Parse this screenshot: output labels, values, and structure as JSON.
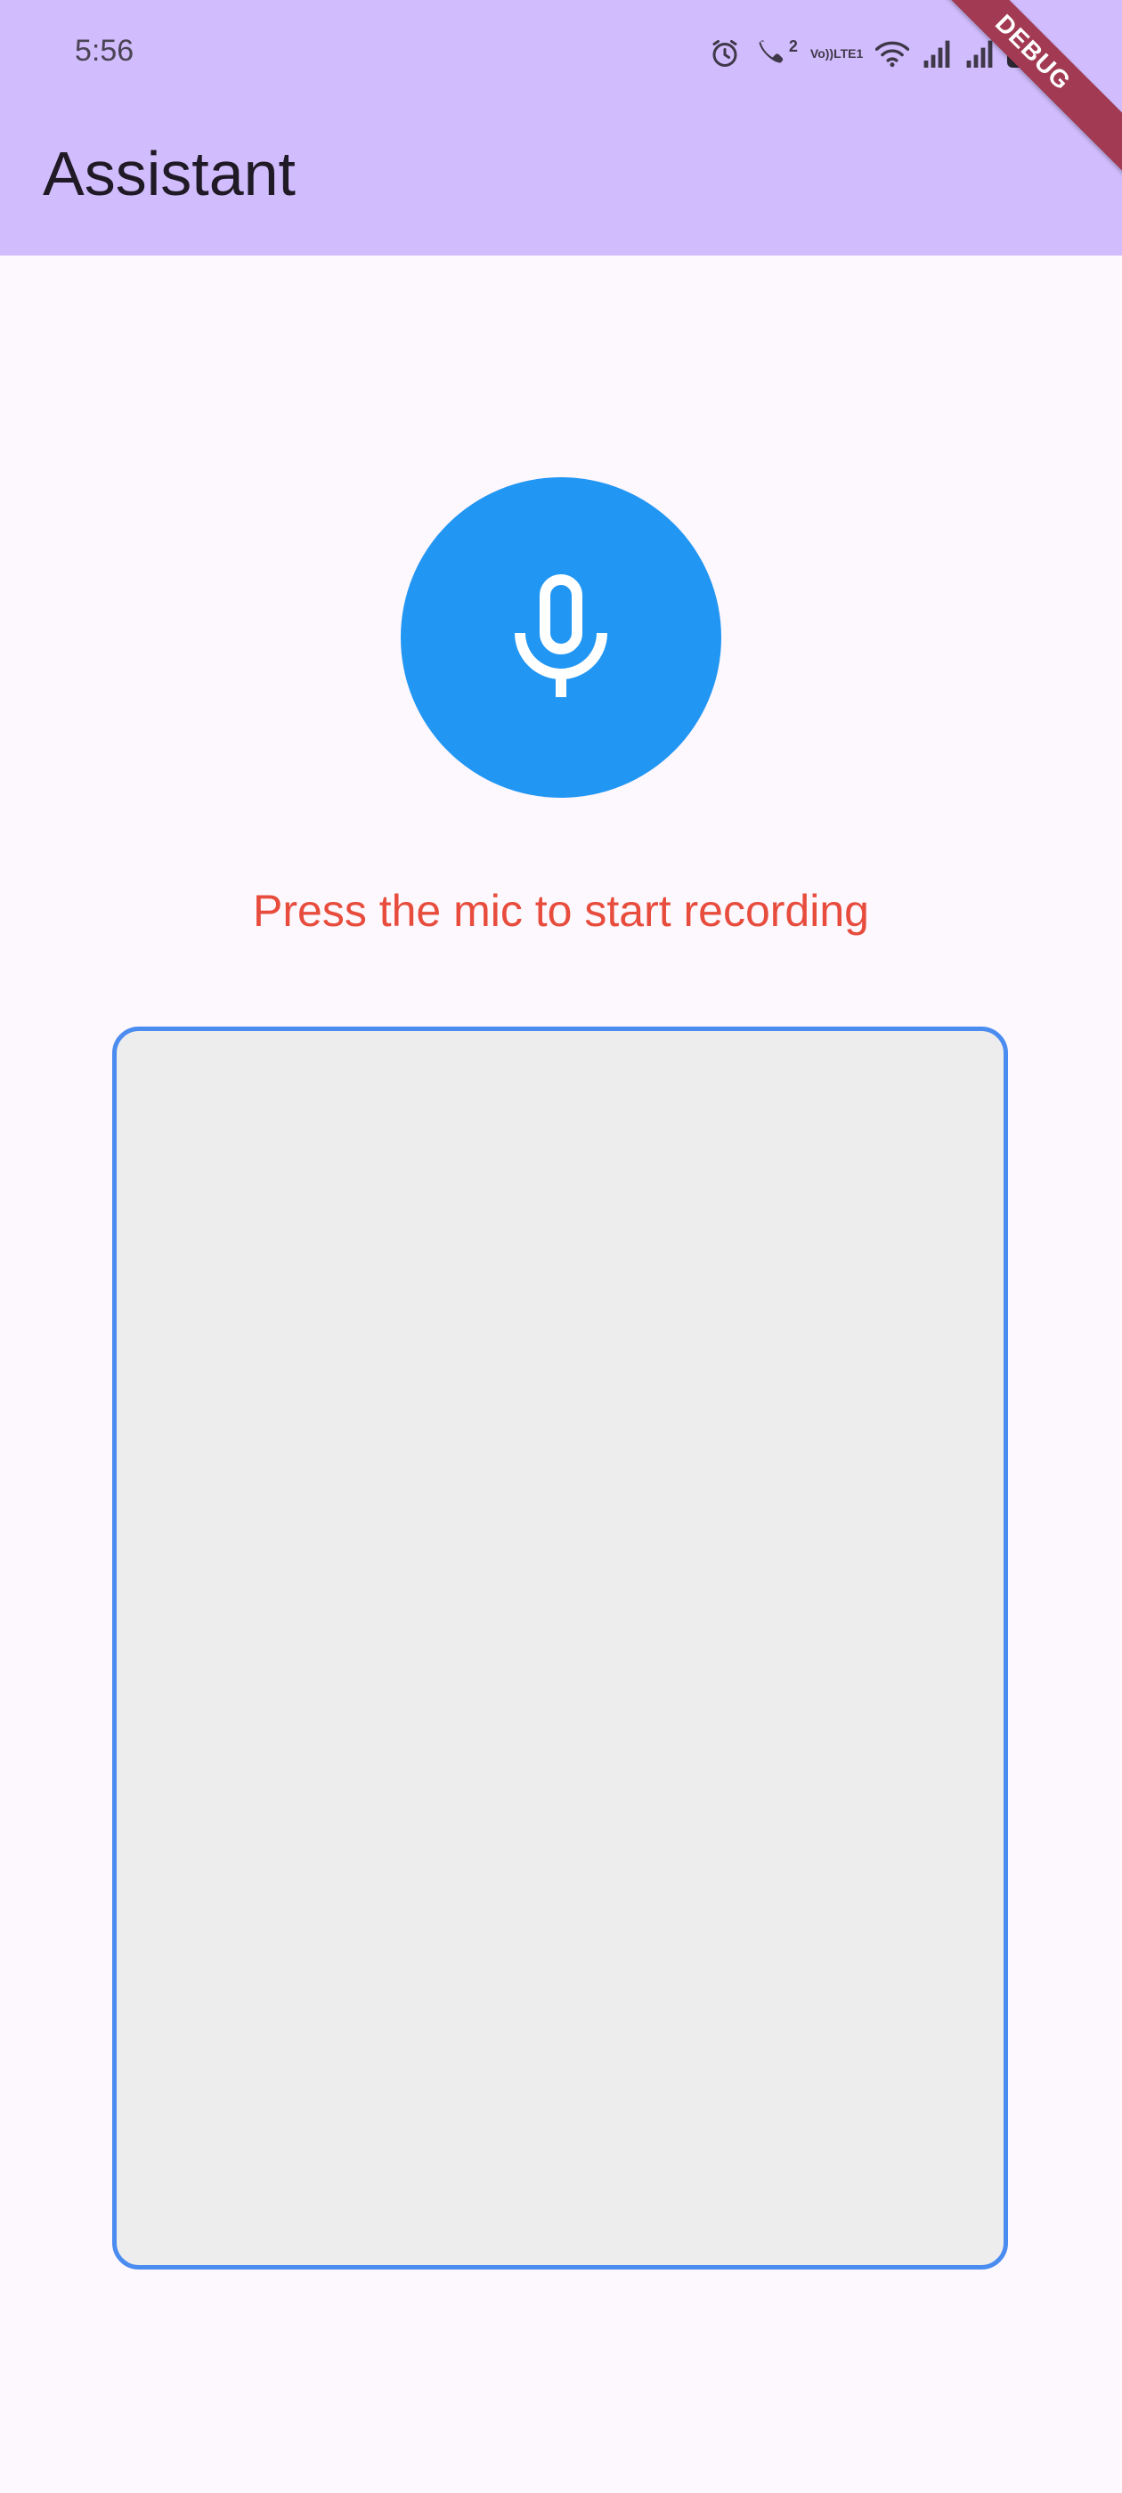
{
  "status_bar": {
    "time": "5:56",
    "icons": [
      "alarm-icon",
      "wifi-call-icon",
      "volte-lte-icon",
      "wifi-icon",
      "signal-icon",
      "signal-icon",
      "battery-icon"
    ],
    "call_badge": "2",
    "volte_top": "Vo))",
    "volte_bottom": "LTE1",
    "battery_level": "75"
  },
  "app_bar": {
    "title": "Assistant",
    "background": "#d1bcfd"
  },
  "debug_banner": "DEBUG",
  "mic_button": {
    "icon": "mic-icon",
    "color": "#2196f3"
  },
  "prompt": {
    "text": "Press the mic to start recording",
    "color": "#e74c3c"
  },
  "transcript": {
    "text": "",
    "border_color": "#4a8cef",
    "background": "#eeeded"
  }
}
